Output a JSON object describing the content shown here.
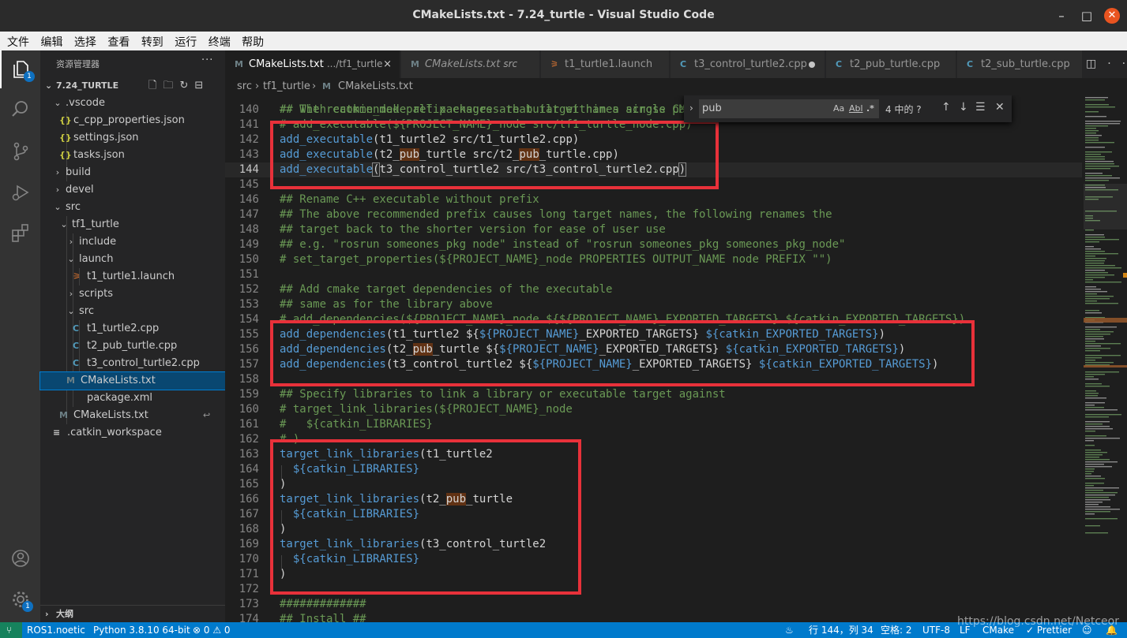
{
  "window": {
    "title": "CMakeLists.txt - 7.24_turtle - Visual Studio Code"
  },
  "menu": [
    "文件",
    "编辑",
    "选择",
    "查看",
    "转到",
    "运行",
    "终端",
    "帮助"
  ],
  "activity": {
    "explorer_badge": "1",
    "settings_badge": "1"
  },
  "sidebar": {
    "header": "资源管理器",
    "more": "···",
    "project": "7.24_TURTLE",
    "items": [
      {
        "label": ".vscode",
        "type": "folder-open"
      },
      {
        "label": "c_cpp_properties.json",
        "type": "json"
      },
      {
        "label": "settings.json",
        "type": "json"
      },
      {
        "label": "tasks.json",
        "type": "json"
      },
      {
        "label": "build",
        "type": "folder"
      },
      {
        "label": "devel",
        "type": "folder"
      },
      {
        "label": "src",
        "type": "folder-open"
      },
      {
        "label": "tf1_turtle",
        "type": "folder-open"
      },
      {
        "label": "include",
        "type": "folder"
      },
      {
        "label": "launch",
        "type": "folder-open"
      },
      {
        "label": "t1_turtle1.launch",
        "type": "launch"
      },
      {
        "label": "scripts",
        "type": "folder"
      },
      {
        "label": "src",
        "type": "folder-open"
      },
      {
        "label": "t1_turtle2.cpp",
        "type": "cpp"
      },
      {
        "label": "t2_pub_turtle.cpp",
        "type": "cpp"
      },
      {
        "label": "t3_control_turtle2.cpp",
        "type": "cpp"
      },
      {
        "label": "CMakeLists.txt",
        "type": "cmake"
      },
      {
        "label": "package.xml",
        "type": "xml"
      },
      {
        "label": "CMakeLists.txt",
        "type": "cmake"
      },
      {
        "label": ".catkin_workspace",
        "type": "text"
      }
    ],
    "outline": "大纲"
  },
  "tabs": [
    {
      "label": "CMakeLists.txt",
      "desc": ".../tf1_turtle",
      "close": "×"
    },
    {
      "label": "CMakeLists.txt",
      "desc": "src"
    },
    {
      "label": "t1_turtle1.launch",
      "desc": ""
    },
    {
      "label": "t3_control_turtle2.cpp",
      "desc": ""
    },
    {
      "label": "t2_pub_turtle.cpp",
      "desc": ""
    },
    {
      "label": "t2_sub_turtle.cpp",
      "desc": ""
    }
  ],
  "breadcrumb": [
    "src",
    "tf1_turtle",
    "CMakeLists.txt"
  ],
  "find": {
    "query": "pub",
    "count": "4 中的 ?",
    "match_case": "Aa",
    "whole_word": "Abl",
    "regex": ".*"
  },
  "editor": {
    "lines": [
      {
        "n": "140",
        "seg": [
          [
            "c",
            "## The recommended prefix ensures that target names across pa"
          ]
        ]
      },
      {
        "n": "141",
        "seg": [
          [
            "c",
            "# add_executable(${PROJECT_NAME}_node src/tf1_turtle_node.cpp)"
          ]
        ]
      },
      {
        "n": "142",
        "seg": [
          [
            "f",
            "add_executable"
          ],
          [
            "t",
            "(t1_turtle2 src/t1_turtle2.cpp)"
          ]
        ]
      },
      {
        "n": "143",
        "seg": [
          [
            "f",
            "add_executable"
          ],
          [
            "t",
            "(t2_"
          ],
          [
            "h",
            "pub"
          ],
          [
            "t",
            "_turtle src/t2_"
          ],
          [
            "h",
            "pub"
          ],
          [
            "t",
            "_turtle.cpp)"
          ]
        ]
      },
      {
        "n": "144",
        "seg": [
          [
            "f",
            "add_executable"
          ],
          [
            "b",
            "("
          ],
          [
            "t",
            "t3_control_turtle2 src/t3_control_turtle2.cpp"
          ],
          [
            "b",
            ")"
          ]
        ]
      },
      {
        "n": "145",
        "seg": []
      },
      {
        "n": "146",
        "seg": [
          [
            "c",
            "## Rename C++ executable without prefix"
          ]
        ]
      },
      {
        "n": "147",
        "seg": [
          [
            "c",
            "## The above recommended prefix causes long target names, the following renames the"
          ]
        ]
      },
      {
        "n": "148",
        "seg": [
          [
            "c",
            "## target back to the shorter version for ease of user use"
          ]
        ]
      },
      {
        "n": "149",
        "seg": [
          [
            "c",
            "## e.g. \"rosrun someones_pkg node\" instead of \"rosrun someones_pkg someones_pkg_node\""
          ]
        ]
      },
      {
        "n": "150",
        "seg": [
          [
            "c",
            "# set_target_properties(${PROJECT_NAME}_node PROPERTIES OUTPUT_NAME node PREFIX \"\")"
          ]
        ]
      },
      {
        "n": "151",
        "seg": []
      },
      {
        "n": "152",
        "seg": [
          [
            "c",
            "## Add cmake target dependencies of the executable"
          ]
        ]
      },
      {
        "n": "153",
        "seg": [
          [
            "c",
            "## same as for the library above"
          ]
        ]
      },
      {
        "n": "154",
        "seg": [
          [
            "c",
            "# add_dependencies(${PROJECT_NAME}_node ${${PROJECT_NAME}_EXPORTED_TARGETS} ${catkin_EXPORTED_TARGETS})"
          ]
        ]
      },
      {
        "n": "155",
        "seg": [
          [
            "f",
            "add_dependencies"
          ],
          [
            "t",
            "(t1_turtle2 ${"
          ],
          [
            "v",
            "${PROJECT_NAME}"
          ],
          [
            "t",
            "_EXPORTED_TARGETS} "
          ],
          [
            "v",
            "${catkin_EXPORTED_TARGETS}"
          ],
          [
            "t",
            ")"
          ]
        ]
      },
      {
        "n": "156",
        "seg": [
          [
            "f",
            "add_dependencies"
          ],
          [
            "t",
            "(t2_"
          ],
          [
            "h",
            "pub"
          ],
          [
            "t",
            "_turtle ${"
          ],
          [
            "v",
            "${PROJECT_NAME}"
          ],
          [
            "t",
            "_EXPORTED_TARGETS} "
          ],
          [
            "v",
            "${catkin_EXPORTED_TARGETS}"
          ],
          [
            "t",
            ")"
          ]
        ]
      },
      {
        "n": "157",
        "seg": [
          [
            "f",
            "add_dependencies"
          ],
          [
            "t",
            "(t3_control_turtle2 ${"
          ],
          [
            "v",
            "${PROJECT_NAME}"
          ],
          [
            "t",
            "_EXPORTED_TARGETS} "
          ],
          [
            "v",
            "${catkin_EXPORTED_TARGETS}"
          ],
          [
            "t",
            ")"
          ]
        ]
      },
      {
        "n": "158",
        "seg": []
      },
      {
        "n": "159",
        "seg": [
          [
            "c",
            "## Specify libraries to link a library or executable target against"
          ]
        ]
      },
      {
        "n": "160",
        "seg": [
          [
            "c",
            "# target_link_libraries(${PROJECT_NAME}_node"
          ]
        ]
      },
      {
        "n": "161",
        "seg": [
          [
            "c",
            "#   ${catkin_LIBRARIES}"
          ]
        ]
      },
      {
        "n": "162",
        "seg": [
          [
            "c",
            "# )"
          ]
        ]
      },
      {
        "n": "163",
        "seg": [
          [
            "f",
            "target_link_libraries"
          ],
          [
            "t",
            "(t1_turtle2"
          ]
        ]
      },
      {
        "n": "164",
        "seg": [
          [
            "t",
            "  "
          ],
          [
            "v",
            "${catkin_LIBRARIES}"
          ]
        ]
      },
      {
        "n": "165",
        "seg": [
          [
            "t",
            ")"
          ]
        ]
      },
      {
        "n": "166",
        "seg": [
          [
            "f",
            "target_link_libraries"
          ],
          [
            "t",
            "(t2_"
          ],
          [
            "h",
            "pub"
          ],
          [
            "t",
            "_turtle"
          ]
        ]
      },
      {
        "n": "167",
        "seg": [
          [
            "t",
            "  "
          ],
          [
            "v",
            "${catkin_LIBRARIES}"
          ]
        ]
      },
      {
        "n": "168",
        "seg": [
          [
            "t",
            ")"
          ]
        ]
      },
      {
        "n": "169",
        "seg": [
          [
            "f",
            "target_link_libraries"
          ],
          [
            "t",
            "(t3_control_turtle2"
          ]
        ]
      },
      {
        "n": "170",
        "seg": [
          [
            "t",
            "  "
          ],
          [
            "v",
            "${catkin_LIBRARIES}"
          ]
        ]
      },
      {
        "n": "171",
        "seg": [
          [
            "t",
            ")"
          ]
        ]
      },
      {
        "n": "172",
        "seg": []
      },
      {
        "n": "173",
        "seg": [
          [
            "c",
            "#############"
          ]
        ]
      },
      {
        "n": "174",
        "seg": [
          [
            "c",
            "## Install ##"
          ]
        ]
      }
    ],
    "current_line": "144",
    "top_partial": "## With catkin_make all packages are built within a single CM"
  },
  "status": {
    "remote": "ROS1.noetic",
    "python": "Python 3.8.10 64-bit",
    "problems": "⊗ 0 ⚠ 0",
    "position": "行 144，列 34",
    "spaces": "空格: 2",
    "encoding": "UTF-8",
    "eol": "LF",
    "language": "CMake",
    "prettier": "✓ Prettier"
  },
  "watermark": "https://blog.csdn.net/Netceor"
}
